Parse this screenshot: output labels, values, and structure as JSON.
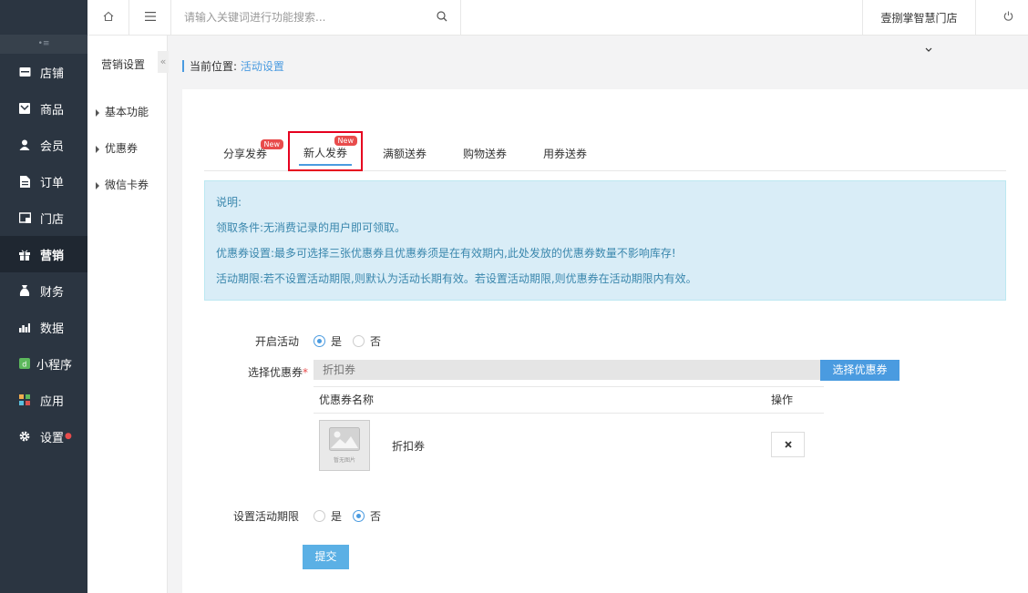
{
  "nav": {
    "toggle_label": "•≡",
    "items": [
      {
        "label": "店铺"
      },
      {
        "label": "商品"
      },
      {
        "label": "会员"
      },
      {
        "label": "订单"
      },
      {
        "label": "门店"
      },
      {
        "label": "营销"
      },
      {
        "label": "财务"
      },
      {
        "label": "数据"
      },
      {
        "label": "小程序"
      },
      {
        "label": "应用"
      },
      {
        "label": "设置"
      }
    ]
  },
  "topbar": {
    "search_placeholder": "请输入关键词进行功能搜索...",
    "store_name": "壹捌掌智慧门店"
  },
  "subnav": {
    "title": "营销设置",
    "collapse_label": "«",
    "items": [
      {
        "label": "基本功能"
      },
      {
        "label": "优惠券"
      },
      {
        "label": "微信卡券"
      }
    ]
  },
  "breadcrumb": {
    "prefix": "当前位置:",
    "current": "活动设置"
  },
  "tabs": [
    {
      "label": "分享发券",
      "badge": "New"
    },
    {
      "label": "新人发券",
      "badge": "New"
    },
    {
      "label": "满额送券"
    },
    {
      "label": "购物送券"
    },
    {
      "label": "用券送券"
    }
  ],
  "notice": {
    "lines": [
      "说明:",
      "领取条件:无消费记录的用户即可领取。",
      "优惠券设置:最多可选择三张优惠券且优惠券须是在有效期内,此处发放的优惠券数量不影响库存!",
      "活动期限:若不设置活动期限,则默认为活动长期有效。若设置活动期限,则优惠券在活动期限内有效。"
    ]
  },
  "form": {
    "open_label": "开启活动",
    "yes": "是",
    "no": "否",
    "coupon_label": "选择优惠券",
    "coupon_required": "*",
    "coupon_placeholder": "折扣券",
    "coupon_button": "选择优惠券",
    "table": {
      "col_name": "优惠券名称",
      "col_action": "操作",
      "rows": [
        {
          "name": "折扣券",
          "thumb_caption": "暂无图片"
        }
      ]
    },
    "period_label": "设置活动期限",
    "submit": "提交"
  },
  "colors": {
    "nav_bg": "#2b3541",
    "accent": "#4a9be0",
    "highlight_box": "#e6001f",
    "badge": "#e84c4c",
    "notice_bg": "#d9edf7"
  }
}
